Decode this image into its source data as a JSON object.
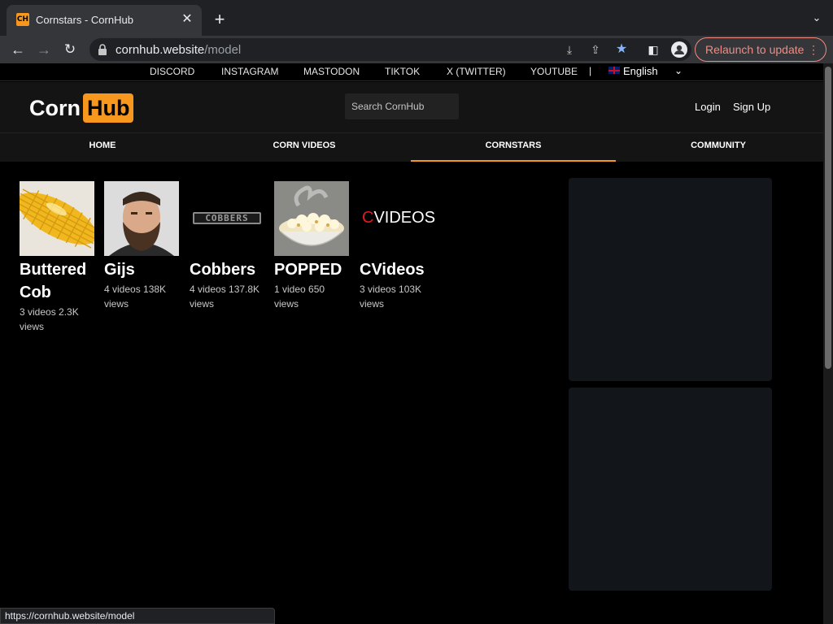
{
  "browser": {
    "tab_title": "Cornstars - CornHub",
    "favicon_text": "CH",
    "url_host": "cornhub.website",
    "url_path": "/model",
    "relaunch_label": "Relaunch to update",
    "status_url": "https://cornhub.website/model"
  },
  "social": {
    "links": [
      "DISCORD",
      "INSTAGRAM",
      "MASTODON",
      "TIKTOK",
      "X (TWITTER)",
      "YOUTUBE"
    ],
    "separator": "|",
    "language": "English"
  },
  "header": {
    "logo_part1": "Corn",
    "logo_part2": "Hub",
    "search_placeholder": "Search CornHub",
    "login": "Login",
    "signup": "Sign Up"
  },
  "nav": {
    "items": [
      "HOME",
      "CORN VIDEOS",
      "CORNSTARS",
      "COMMUNITY"
    ],
    "active": "CORNSTARS"
  },
  "cornstars": [
    {
      "name": "Buttered Cob",
      "meta": "3 videos 2.3K views",
      "image": "corn-cob"
    },
    {
      "name": "Gijs",
      "meta": "4 videos 138K views",
      "image": "man-portrait"
    },
    {
      "name": "Cobbers",
      "meta": "4 videos 137.8K views",
      "image": "cobbers-logo"
    },
    {
      "name": "POPPED",
      "meta": "1 video 650 views",
      "image": "popcorn-bowl"
    },
    {
      "name": "CVideos",
      "meta": "3 videos 103K views",
      "image": "cvideos-logo"
    }
  ],
  "logos": {
    "cobbers_text": "COBBERS",
    "cvideos_c": "C",
    "cvideos_rest": "VIDEOS"
  },
  "colors": {
    "accent": "#f7971d",
    "background": "#000000",
    "header_bg": "#141414",
    "ad_bg": "#12161b"
  }
}
